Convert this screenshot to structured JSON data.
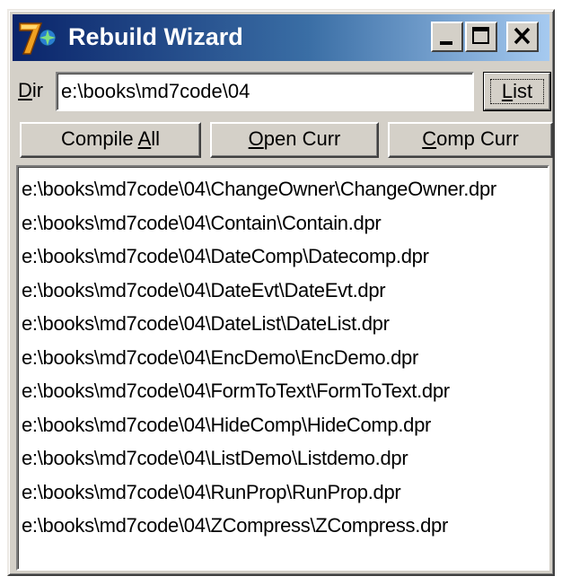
{
  "window": {
    "title": "Rebuild Wizard",
    "icon": "delphi-7-icon",
    "caption_buttons": [
      "minimize-icon",
      "maximize-icon",
      "close-icon"
    ]
  },
  "dir": {
    "label_prefix": "D",
    "label_rest": "ir",
    "value": "e:\\books\\md7code\\04"
  },
  "buttons": {
    "list": {
      "u": "L",
      "rest": "ist"
    },
    "compile_all": {
      "pre": "Compile ",
      "u": "A",
      "rest": "ll"
    },
    "open_curr": {
      "pre": "",
      "u": "O",
      "rest": "pen Curr"
    },
    "comp_curr": {
      "pre": "",
      "u": "C",
      "rest": "omp Curr"
    }
  },
  "files": [
    "e:\\books\\md7code\\04\\ChangeOwner\\ChangeOwner.dpr",
    "e:\\books\\md7code\\04\\Contain\\Contain.dpr",
    "e:\\books\\md7code\\04\\DateComp\\Datecomp.dpr",
    "e:\\books\\md7code\\04\\DateEvt\\DateEvt.dpr",
    "e:\\books\\md7code\\04\\DateList\\DateList.dpr",
    "e:\\books\\md7code\\04\\EncDemo\\EncDemo.dpr",
    "e:\\books\\md7code\\04\\FormToText\\FormToText.dpr",
    "e:\\books\\md7code\\04\\HideComp\\HideComp.dpr",
    "e:\\books\\md7code\\04\\ListDemo\\Listdemo.dpr",
    "e:\\books\\md7code\\04\\RunProp\\RunProp.dpr",
    "e:\\books\\md7code\\04\\ZCompress\\ZCompress.dpr"
  ],
  "colors": {
    "titlebar_start": "#0a246a",
    "titlebar_end": "#a6caf0",
    "face": "#d4d0c8"
  }
}
